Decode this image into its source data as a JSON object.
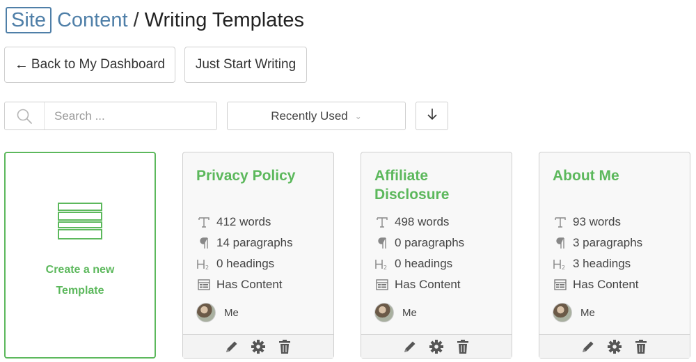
{
  "header": {
    "logo_site": "Site",
    "logo_content": "Content",
    "separator": "/",
    "title": "Writing Templates"
  },
  "actions": {
    "back_label": "Back to My Dashboard",
    "back_arrow": "←",
    "write_label": "Just Start Writing"
  },
  "search": {
    "placeholder": "Search ..."
  },
  "sort": {
    "selected": "Recently Used",
    "direction": "descending"
  },
  "create_card": {
    "line1": "Create a new",
    "line2": "Template",
    "accent_color": "#5cb85c"
  },
  "templates": [
    {
      "title": "Privacy Policy",
      "words": "412 words",
      "paragraphs": "14 paragraphs",
      "headings": "0 headings",
      "content": "Has Content",
      "owner": "Me"
    },
    {
      "title": "Affiliate Disclosure",
      "words": "498 words",
      "paragraphs": "0 paragraphs",
      "headings": "0 headings",
      "content": "Has Content",
      "owner": "Me"
    },
    {
      "title": "About Me",
      "words": "93 words",
      "paragraphs": "3 paragraphs",
      "headings": "3 headings",
      "content": "Has Content",
      "owner": "Me"
    }
  ],
  "icons": {
    "words": "text-t-icon",
    "paragraphs": "pilcrow-icon",
    "headings": "heading-h2-icon",
    "content": "content-grid-icon",
    "edit": "pencil-icon",
    "settings": "gear-icon",
    "delete": "trash-icon"
  },
  "colors": {
    "brand_blue": "#4f7fa8",
    "accent_green": "#5cb85c"
  }
}
